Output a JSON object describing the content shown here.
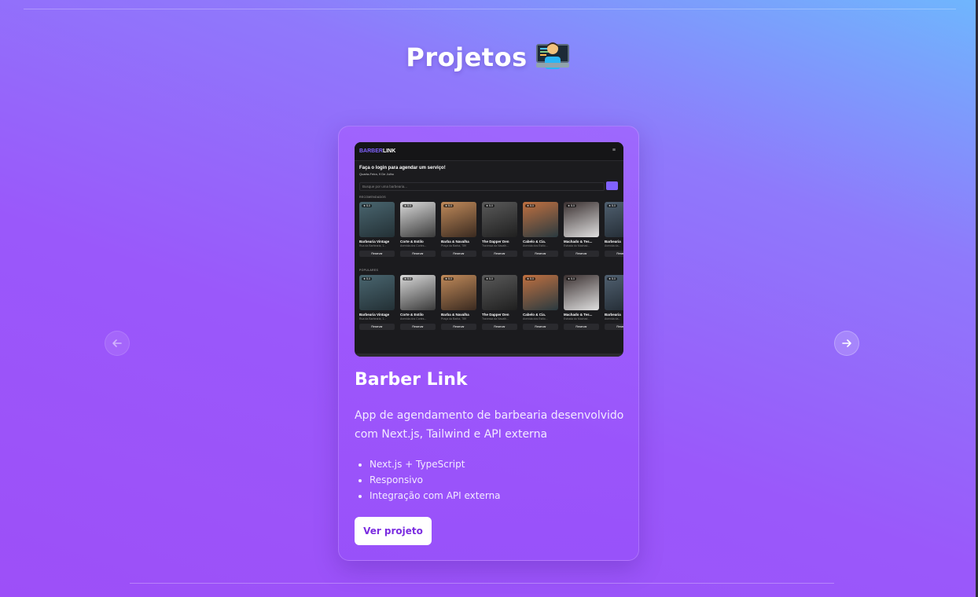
{
  "section": {
    "title": "Projetos",
    "emoji": "technologist-emoji"
  },
  "nav": {
    "prev_icon": "arrow-left-icon",
    "next_icon": "arrow-right-icon"
  },
  "project": {
    "name": "Barber Link",
    "description": "App de agendamento de barbearia desenvolvido com Next.js, Tailwind e API externa",
    "tech": [
      "Next.js + TypeScript",
      "Responsivo",
      "Integração com API externa"
    ],
    "button_label": "Ver projeto",
    "screenshot": {
      "logo_prefix": "BARBER",
      "logo_suffix": "LINK",
      "menu_icon": "menu-icon",
      "greeting": "Faça o login para agendar um serviço!",
      "date": "Quarta-Feira, 9 De Julho",
      "search_placeholder": "Busque por uma barbearia...",
      "recommended_label": "RECOMENDADOS",
      "popular_label": "POPULARES",
      "reserve_label": "Reservar",
      "rating": "★ 5.0",
      "shops": [
        {
          "name": "Barbearia Vintage",
          "address": "Rua da Barbearia, 1..."
        },
        {
          "name": "Corte & Estilo",
          "address": "Avenida dos Cortes..."
        },
        {
          "name": "Barba & Navalha",
          "address": "Praça da Barba, 789"
        },
        {
          "name": "The Dapper Den",
          "address": "Travessa da Navalh..."
        },
        {
          "name": "Cabelo & Cia.",
          "address": "Avenida dos Estilo..."
        },
        {
          "name": "Machado & Tes...",
          "address": "Estrada do Machad..."
        },
        {
          "name": "Barbearia",
          "address": "Avenida da..."
        }
      ]
    }
  },
  "colors": {
    "accent": "#8162ff",
    "button_text": "#7b2de0"
  }
}
